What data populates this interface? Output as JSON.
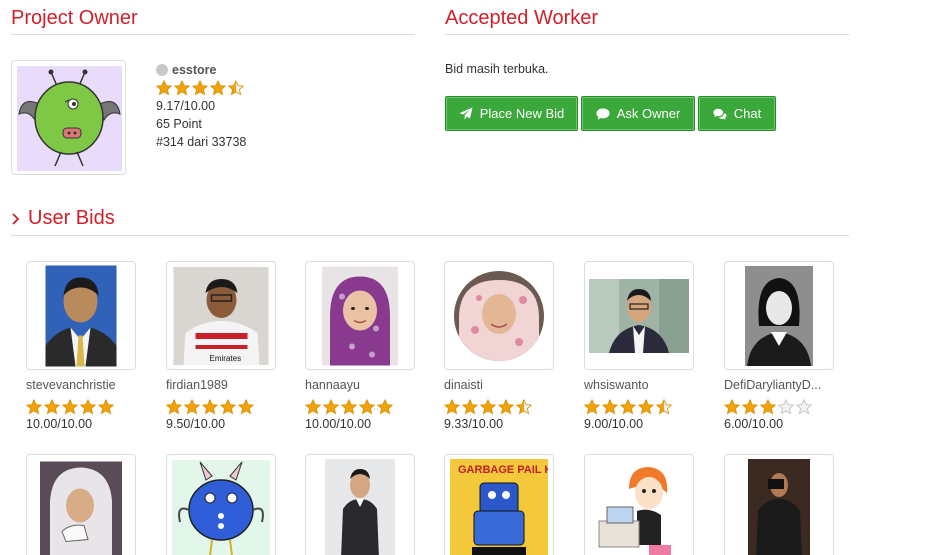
{
  "owner": {
    "title": "Project Owner",
    "name": "esstore",
    "rating": 4.5,
    "score": "9.17/10.00",
    "points": "65 Point",
    "rank": "#314 dari 33738"
  },
  "worker": {
    "title": "Accepted Worker",
    "status": "Bid masih terbuka.",
    "buttons": {
      "place_bid": "Place New Bid",
      "ask_owner": "Ask Owner",
      "chat": "Chat"
    }
  },
  "bids": {
    "title": "User Bids",
    "items": [
      {
        "name": "stevevanchristie",
        "rating": 5,
        "score": "10.00/10.00"
      },
      {
        "name": "firdian1989",
        "rating": 5,
        "score": "9.50/10.00"
      },
      {
        "name": "hannaayu",
        "rating": 5,
        "score": "10.00/10.00"
      },
      {
        "name": "dinaisti",
        "rating": 4.5,
        "score": "9.33/10.00"
      },
      {
        "name": "whsiswanto",
        "rating": 4.5,
        "score": "9.00/10.00"
      },
      {
        "name": "DefiDaryliantyD...",
        "rating": 3,
        "score": "6.00/10.00"
      }
    ]
  },
  "colors": {
    "accent": "#d0202a",
    "button": "#3aa83a",
    "star": "#f0a30a"
  }
}
